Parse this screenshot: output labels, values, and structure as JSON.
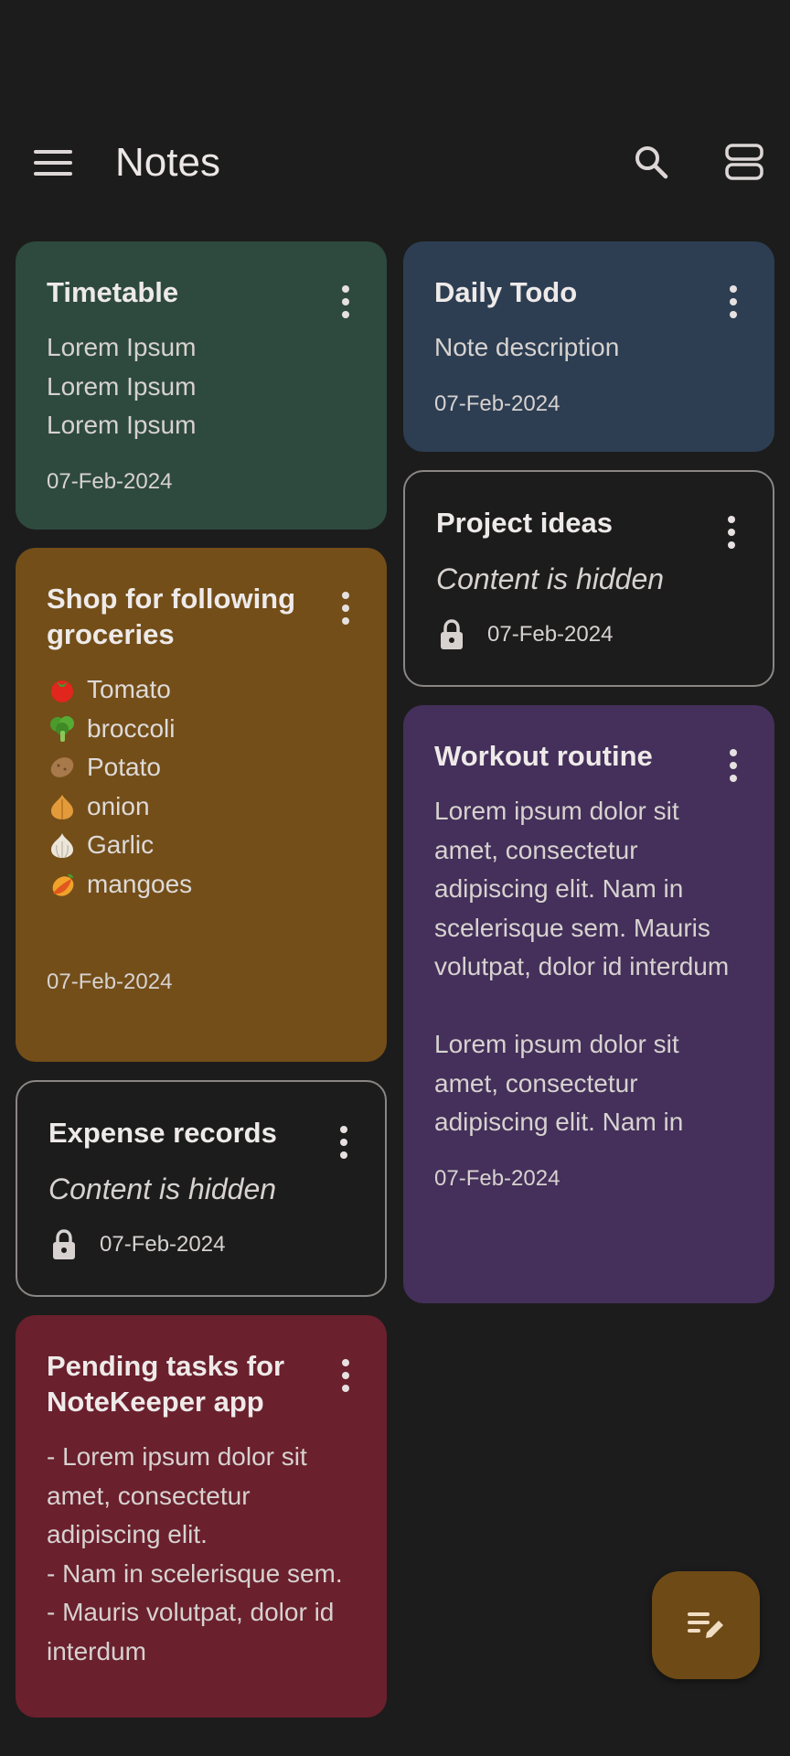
{
  "colors": {
    "background": "#1c1c1c",
    "card_green": "#2e4a3e",
    "card_blue": "#2d3e52",
    "card_orange": "#734e19",
    "card_purple": "#44305a",
    "card_red": "#6a202d",
    "fab": "#6e4a16"
  },
  "topbar": {
    "title": "Notes",
    "menu_icon": "hamburger-menu-icon",
    "search_icon": "search-icon",
    "layout_icon": "view-agenda-icon"
  },
  "notes": {
    "timetable": {
      "title": "Timetable",
      "body": "Lorem Ipsum\nLorem Ipsum\nLorem Ipsum",
      "date": "07-Feb-2024"
    },
    "daily_todo": {
      "title": "Daily Todo",
      "body": "Note description",
      "date": "07-Feb-2024"
    },
    "project_ideas": {
      "title": "Project ideas",
      "hidden": "Content is hidden",
      "date": "07-Feb-2024"
    },
    "groceries": {
      "title": "Shop for following groceries",
      "items": [
        "Tomato",
        "broccoli",
        "Potato",
        "onion",
        "Garlic",
        "mangoes"
      ],
      "date": "07-Feb-2024"
    },
    "workout": {
      "title": "Workout routine",
      "body": "Lorem ipsum dolor sit amet, consectetur adipiscing elit. Nam in scelerisque sem. Mauris volutpat, dolor id interdum\n\nLorem ipsum dolor sit amet, consectetur adipiscing elit. Nam in",
      "date": "07-Feb-2024"
    },
    "expense": {
      "title": "Expense records",
      "hidden": "Content is hidden",
      "date": "07-Feb-2024"
    },
    "pending": {
      "title": "Pending tasks for NoteKeeper app",
      "body": "- Lorem ipsum dolor sit amet, consectetur adipiscing elit.\n- Nam in scelerisque sem.\n- Mauris volutpat, dolor id interdum"
    }
  },
  "fab": {
    "icon": "edit-note-icon"
  }
}
